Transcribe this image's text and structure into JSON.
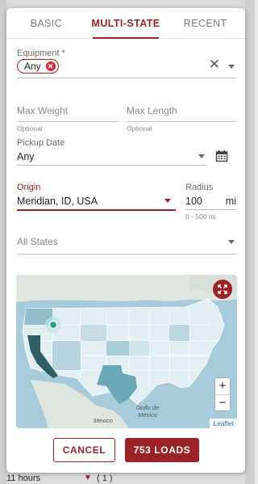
{
  "tabs": [
    {
      "label": "BASIC",
      "active": false
    },
    {
      "label": "MULTI-STATE",
      "active": true
    },
    {
      "label": "RECENT",
      "active": false
    }
  ],
  "equipment": {
    "label": "Equipment *",
    "chip": "Any"
  },
  "max_weight": {
    "placeholder": "Max Weight",
    "helper": "Optional"
  },
  "max_length": {
    "placeholder": "Max Length",
    "helper": "Optional"
  },
  "pickup_date": {
    "label": "Pickup Date",
    "value": "Any"
  },
  "origin": {
    "label": "Origin",
    "value": "Meridian, ID, USA"
  },
  "radius": {
    "label": "Radius",
    "value": "100",
    "unit": "mi",
    "helper": "0 - 500 mi"
  },
  "states": {
    "placeholder": "All States"
  },
  "map": {
    "label_mexico": "México",
    "label_gulf": "Golfo de México",
    "attribution": "Leaflet",
    "zoom_in": "+",
    "zoom_out": "−"
  },
  "actions": {
    "cancel": "CANCEL",
    "loads": "753 LOADS"
  },
  "background": {
    "text": "11 hours",
    "text2": "( 1 )"
  },
  "colors": {
    "accent": "#9b2226",
    "map_water": "#a8cbdc"
  }
}
